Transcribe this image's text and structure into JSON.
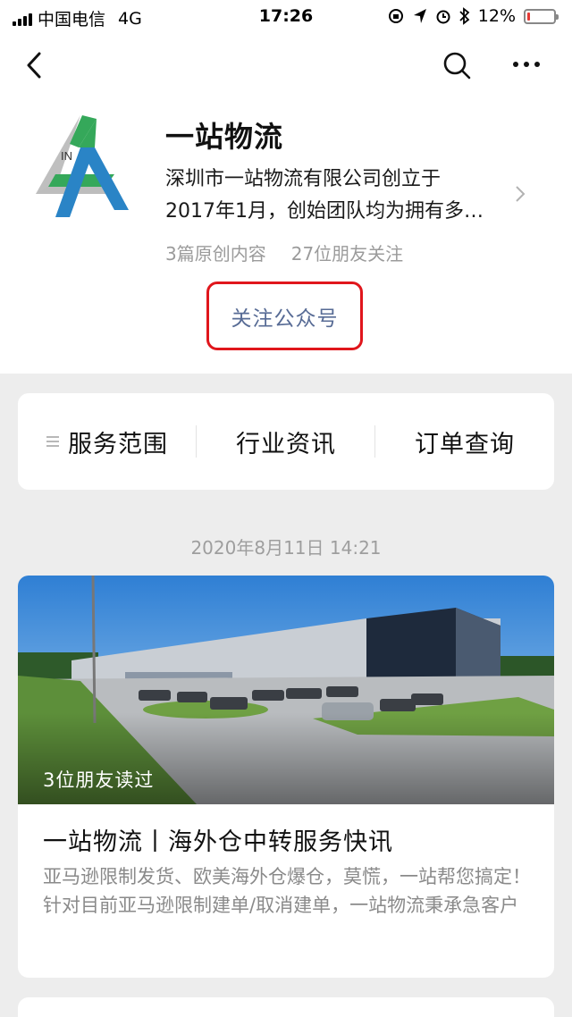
{
  "status_bar": {
    "carrier": "中国电信",
    "network": "4G",
    "time": "17:26",
    "battery": "12%",
    "battery_level": 0.12
  },
  "nav": {
    "back_icon": "chevron-left-icon",
    "search_icon": "search-icon",
    "more_icon": "more-icon"
  },
  "profile": {
    "name": "一站物流",
    "description_line1": "深圳市一站物流有限公司创立于",
    "description_line2": "2017年1月，创始团队均为拥有多…",
    "original_count": "3篇原创内容",
    "friends_following": "27位朋友关注",
    "follow_label": "关注公众号",
    "logo_text": "IN"
  },
  "menu": {
    "items": [
      {
        "label": "服务范围"
      },
      {
        "label": "行业资讯"
      },
      {
        "label": "订单查询"
      }
    ]
  },
  "feed": {
    "date": "2020年8月11日 14:21",
    "article": {
      "readers": "3位朋友读过",
      "title": "一站物流丨海外仓中转服务快讯",
      "digest": "亚马逊限制发货、欧美海外仓爆仓，莫慌，一站帮您搞定！  针对目前亚马逊限制建单/取消建单，一站物流秉承急客户"
    }
  },
  "colors": {
    "link": "#576b95",
    "highlight_border": "#e0161c",
    "page_bg": "#ededed",
    "battery_low": "#e53935"
  }
}
